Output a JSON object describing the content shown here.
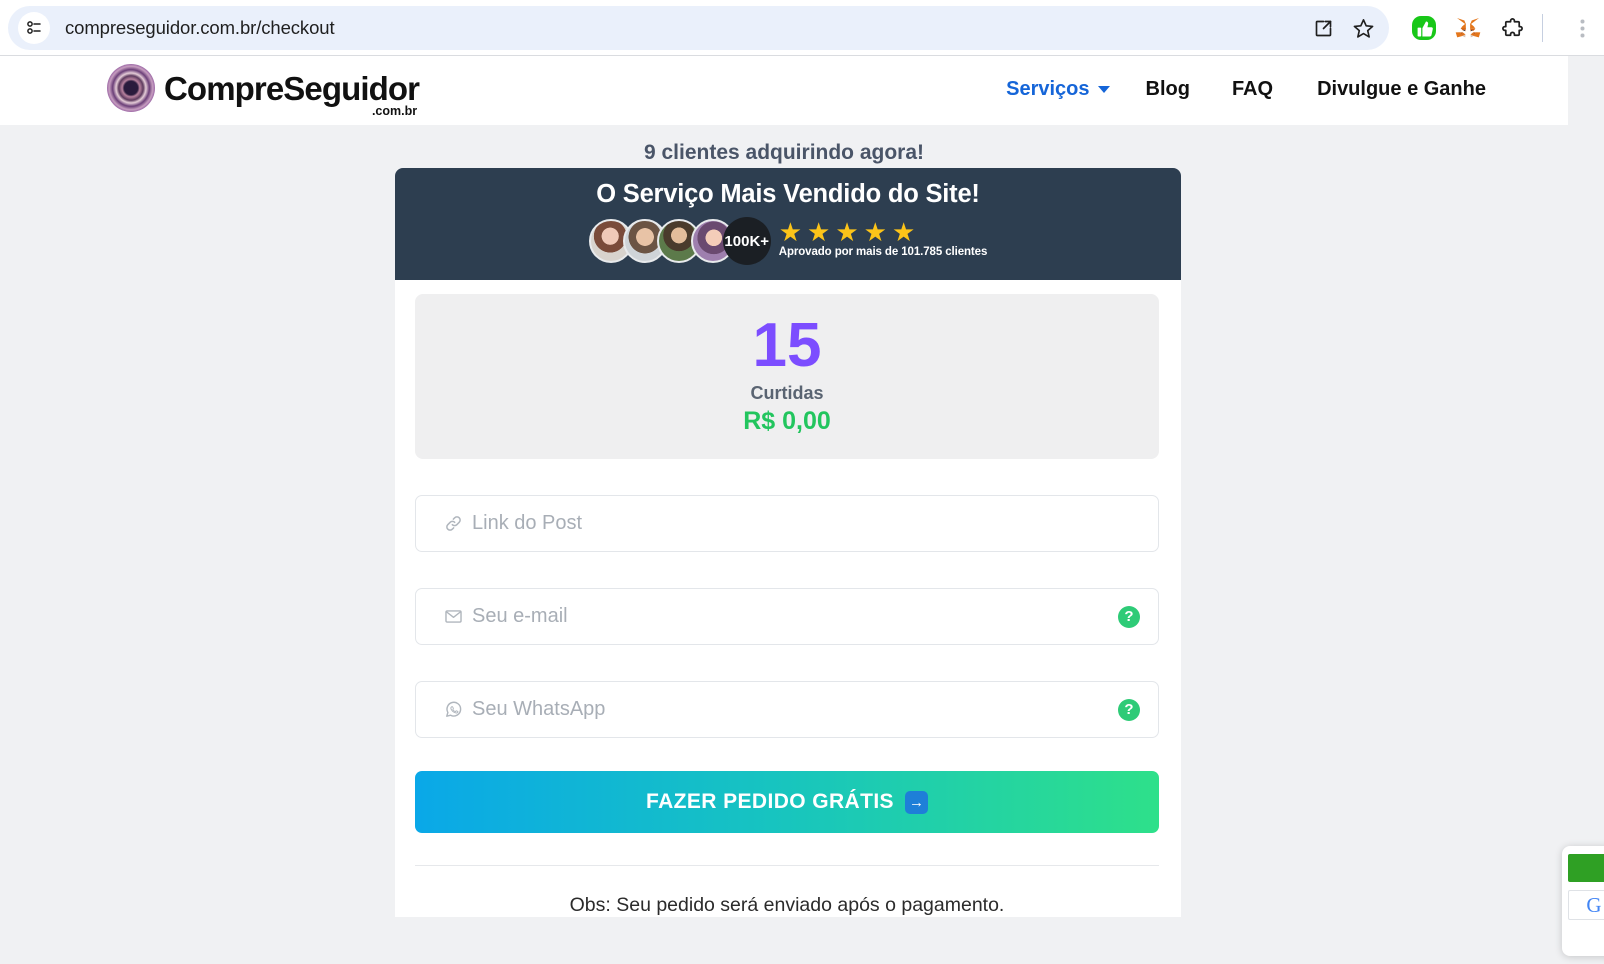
{
  "browser": {
    "url": "compreseguidor.com.br/checkout",
    "site_settings_icon": "tune-icon",
    "toolbar_icons": [
      {
        "name": "share-icon",
        "label": "Share this page"
      },
      {
        "name": "bookmark-star-icon",
        "label": "Bookmark this tab"
      },
      {
        "name": "extension-green-thumbsup-icon",
        "label": "Extension"
      },
      {
        "name": "metamask-fox-icon",
        "label": "MetaMask"
      },
      {
        "name": "extensions-puzzle-icon",
        "label": "Extensions"
      }
    ]
  },
  "site": {
    "logo": {
      "text": "CompreSeguidor",
      "tld": ".com.br",
      "mark": "heart-circle-icon"
    },
    "nav": {
      "servicos": "Serviços",
      "blog": "Blog",
      "faq": "FAQ",
      "divulgue": "Divulgue e Ganhe"
    }
  },
  "promo": {
    "live_buyers_text": "9 clientes adquirindo agora!"
  },
  "banner": {
    "title": "O Serviço Mais Vendido do Site!",
    "avatar_count_badge": "100K+",
    "stars": 5,
    "approved_text": "Aprovado por mais de 101.785 clientes"
  },
  "order": {
    "quantity": "15",
    "unit_label": "Curtidas",
    "price": "R$ 0,00"
  },
  "form": {
    "post_link": {
      "placeholder": "Link do Post",
      "value": "",
      "icon": "link-icon"
    },
    "email": {
      "placeholder": "Seu e-mail",
      "value": "",
      "icon": "envelope-icon",
      "help": "?"
    },
    "whatsapp": {
      "placeholder": "Seu WhatsApp",
      "value": "",
      "icon": "whatsapp-icon",
      "help": "?"
    },
    "submit_label": "FAZER PEDIDO GRÁTIS",
    "submit_arrow": "→",
    "note": "Obs: Seu pedido será enviado após o pagamento."
  },
  "review_widget": {
    "brand_letter": "G"
  },
  "colors": {
    "banner_bg": "#2d3e50",
    "quantity_purple": "#7c4dff",
    "price_green": "#22c55e",
    "cta_gradient_from": "#0aa8e8",
    "cta_gradient_to": "#2ee08a",
    "star_yellow": "#fcc419",
    "nav_accent_blue": "#1565d8",
    "help_badge_green": "#2ecb77"
  }
}
